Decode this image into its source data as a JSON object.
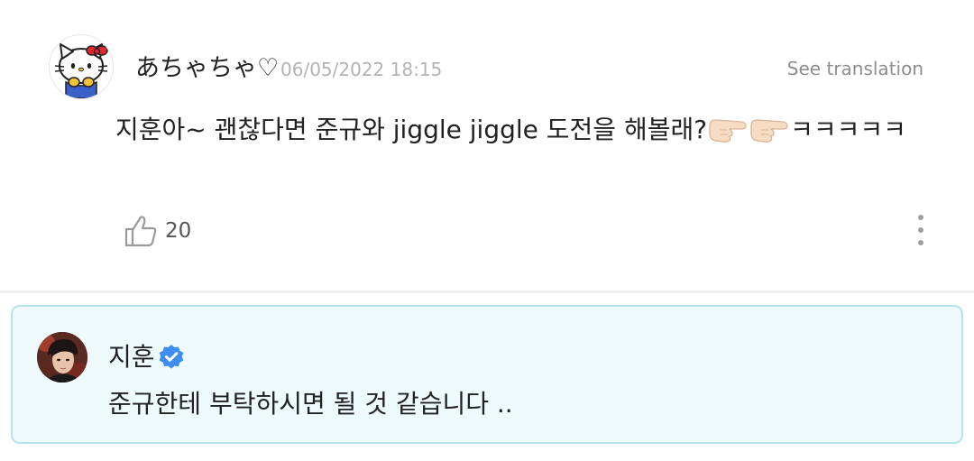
{
  "comment": {
    "username": "あちゃちゃ♡",
    "timestamp": "06/05/2022 18:15",
    "see_translation": "See translation",
    "text_main": "지훈아~ 괜찮다면 준규와 jiggle jiggle 도전을 해볼래?",
    "text_tail": "ㅋㅋㅋㅋㅋ",
    "emojis": [
      "backhand-index-pointing-right",
      "backhand-index-pointing-right"
    ],
    "like_count": "20"
  },
  "reply": {
    "author": "지훈",
    "verified": true,
    "text": "준규한테 부탁하시면 될 것 같습니다 ..",
    "accent_border": "#b4e3ea",
    "accent_bg": "#eefafc",
    "verified_color": "#3d8ef0"
  }
}
